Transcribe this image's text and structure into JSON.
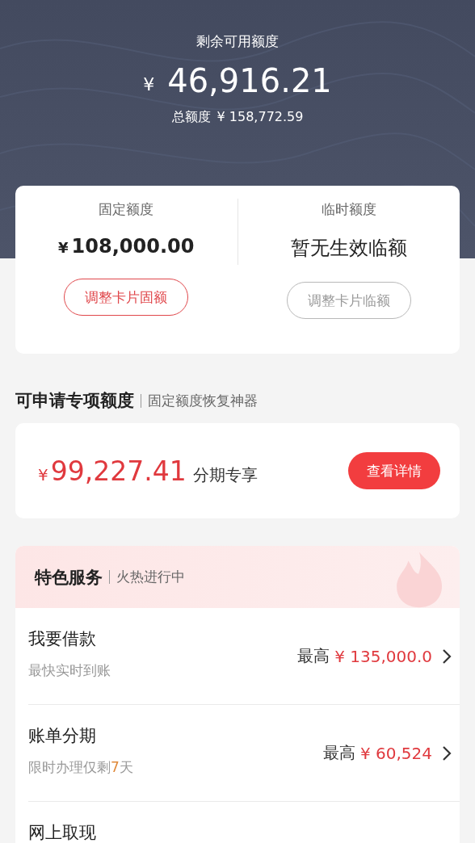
{
  "header": {
    "label": "剩余可用额度",
    "currency": "¥",
    "amount": "46,916.21",
    "total_label": "总额度",
    "total_amount": "¥ 158,772.59"
  },
  "limits": [
    {
      "label": "固定额度",
      "currency": "¥",
      "value": "108,000.00",
      "button": "调整卡片固额",
      "disabled": false
    },
    {
      "label": "临时额度",
      "value": "暂无生效临额",
      "button": "调整卡片临额",
      "disabled": true
    }
  ],
  "special": {
    "title": "可申请专项额度",
    "subtitle": "固定额度恢复神器",
    "currency": "¥",
    "amount": "99,227.41",
    "note": "分期专享",
    "button": "查看详情"
  },
  "features": {
    "title": "特色服务",
    "subtitle": "火热进行中",
    "items": [
      {
        "title": "我要借款",
        "subtitle": [
          {
            "kind": "plain",
            "text": "最快实时到账"
          }
        ],
        "prefix": "最高",
        "amount": "¥ 135,000.0"
      },
      {
        "title": "账单分期",
        "subtitle": [
          {
            "kind": "plain",
            "text": "限时办理仅剩"
          },
          {
            "kind": "highlight",
            "text": "7"
          },
          {
            "kind": "plain",
            "text": "天"
          }
        ],
        "prefix": "最高",
        "amount": "¥ 60,524"
      },
      {
        "title": "网上取现"
      }
    ]
  }
}
